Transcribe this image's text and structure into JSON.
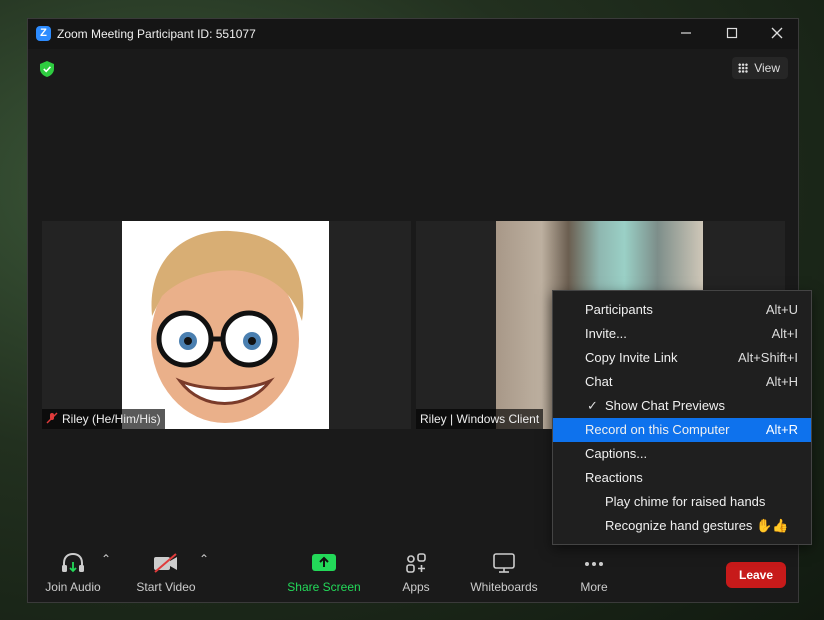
{
  "window": {
    "title": "Zoom Meeting Participant ID: 551077",
    "minimize_icon": "minimize-icon",
    "maximize_icon": "maximize-icon",
    "close_icon": "close-icon"
  },
  "top": {
    "view_label": "View",
    "security_color": "#2ecc40"
  },
  "participants": [
    {
      "name": "Riley (He/Him/His)",
      "muted": true
    },
    {
      "name": "Riley | Windows Client"
    }
  ],
  "toolbar": {
    "join_audio": "Join Audio",
    "start_video": "Start Video",
    "share_screen": "Share Screen",
    "apps": "Apps",
    "whiteboards": "Whiteboards",
    "more": "More",
    "leave": "Leave",
    "share_color": "#23d959",
    "leave_color": "#c71a1a"
  },
  "menu": {
    "items": [
      {
        "label": "Participants",
        "shortcut": "Alt+U"
      },
      {
        "label": "Invite...",
        "shortcut": "Alt+I"
      },
      {
        "label": "Copy Invite Link",
        "shortcut": "Alt+Shift+I"
      },
      {
        "label": "Chat",
        "shortcut": "Alt+H"
      },
      {
        "label": "Show Chat Previews",
        "checked": true
      },
      {
        "label": "Record on this Computer",
        "shortcut": "Alt+R",
        "highlighted": true
      },
      {
        "label": "Captions..."
      },
      {
        "label": "Reactions"
      },
      {
        "label": "Play chime for raised hands"
      },
      {
        "label": "Recognize hand gestures ✋👍"
      }
    ],
    "highlight_color": "#0e72ed"
  }
}
